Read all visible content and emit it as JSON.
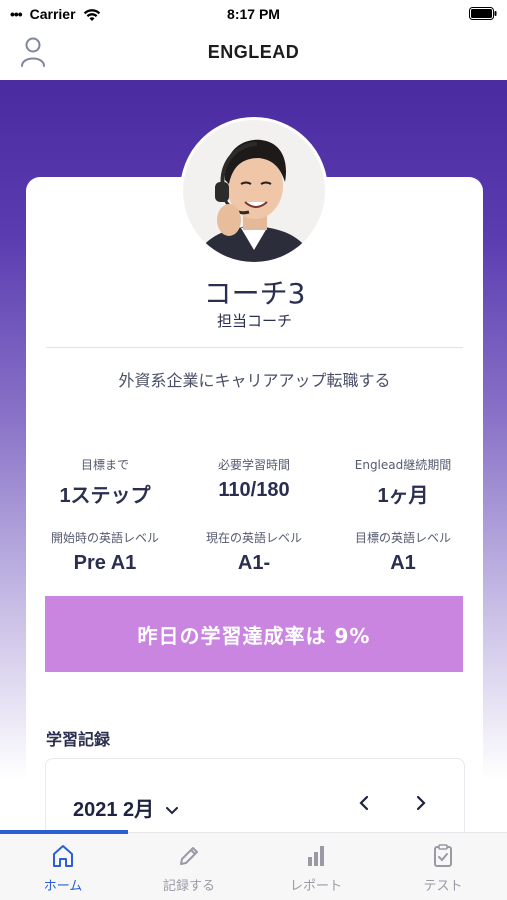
{
  "status_bar": {
    "carrier": "Carrier",
    "time": "8:17 PM"
  },
  "nav": {
    "title": "ENGLEAD",
    "profile_icon": "person-outline-icon"
  },
  "coach": {
    "name": "コーチ3",
    "role": "担当コーチ",
    "avatar_icon": "coach-photo"
  },
  "goal": "外資系企業にキャリアアップ転職する",
  "stats": [
    {
      "label": "目標まで",
      "value": "1ステップ"
    },
    {
      "label": "必要学習時間",
      "value": "110/180"
    },
    {
      "label": "Englead継続期間",
      "value": "1ヶ月"
    },
    {
      "label": "開始時の英語レベル",
      "value": "Pre A1"
    },
    {
      "label": "現在の英語レベル",
      "value": "A1-"
    },
    {
      "label": "目標の英語レベル",
      "value": "A1"
    }
  ],
  "achievement": "昨日の学習達成率は 9%",
  "study_record": {
    "title": "学習記録",
    "month": "2021 2月"
  },
  "tabs": [
    {
      "label": "ホーム",
      "icon": "home-icon",
      "active": true
    },
    {
      "label": "記録する",
      "icon": "pencil-icon",
      "active": false
    },
    {
      "label": "レポート",
      "icon": "bar-chart-icon",
      "active": false
    },
    {
      "label": "テスト",
      "icon": "clipboard-check-icon",
      "active": false
    }
  ],
  "colors": {
    "gradient_top": "#4a2ba0",
    "banner": "#c985e0",
    "tab_active": "#2c5fd6",
    "tab_inactive": "#9a9aa5"
  }
}
